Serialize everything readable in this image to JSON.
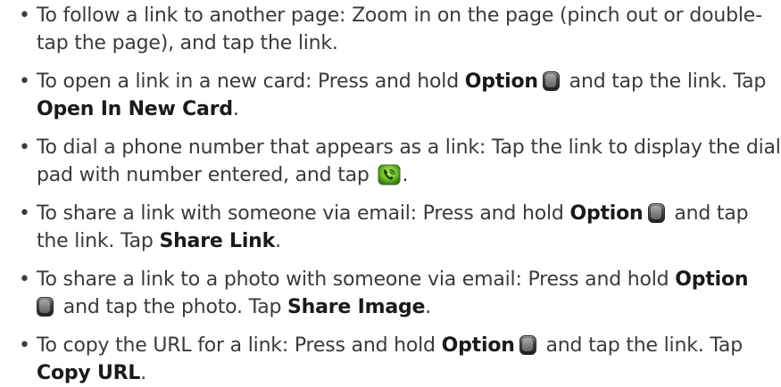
{
  "items": [
    {
      "text1": "To follow a link to another page: Zoom in on the page (pinch out or double-tap the page), and tap the link."
    },
    {
      "text1": "To open a link in a new card: Press and hold ",
      "bold1": "Option",
      "text2": " and tap the link. Tap ",
      "bold2": "Open In New Card",
      "text3": ".",
      "icon": "option-key-icon"
    },
    {
      "text1": "To dial a phone number that appears as a link: Tap the link to display the dial pad with number entered, and tap ",
      "text2": ".",
      "icon": "phone-call-icon"
    },
    {
      "text1": "To share a link with someone via email: Press and hold ",
      "bold1": "Option",
      "text2": " and tap the link. Tap ",
      "bold2": "Share Link",
      "text3": ".",
      "icon": "option-key-icon"
    },
    {
      "text1": "To share a link to a photo with someone via email: Press and hold ",
      "bold1": "Option",
      "text2": " and tap the photo. Tap ",
      "bold2": "Share Image",
      "text3": ".",
      "icon": "option-key-icon"
    },
    {
      "text1": "To copy the URL for a link: Press and hold ",
      "bold1": "Option",
      "text2": " and tap the link. Tap ",
      "bold2": "Copy URL",
      "text3": ".",
      "icon": "option-key-icon"
    }
  ],
  "bullet_char": "•",
  "colors": {
    "text": "#3a3a3a",
    "bold": "#1a1a1a",
    "phone_icon_green": "#6fbf2a"
  }
}
